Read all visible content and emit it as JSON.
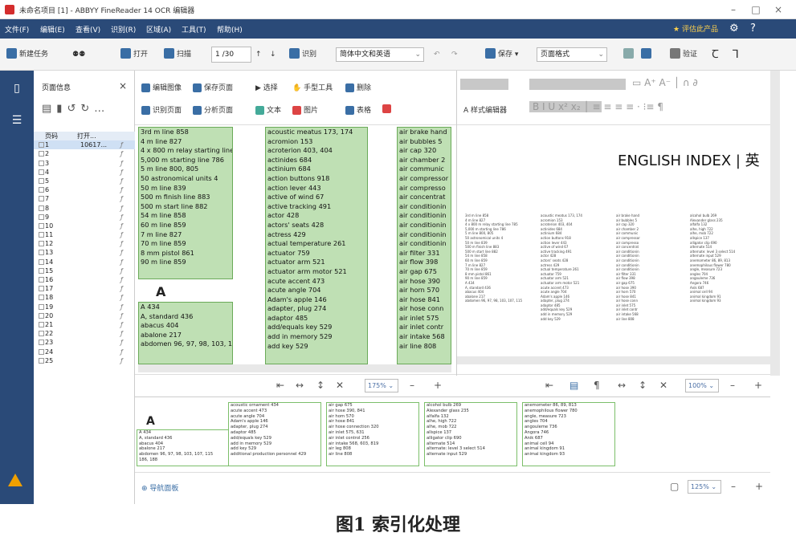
{
  "window": {
    "title": "未命名项目 [1] - ABBYY FineReader 14 OCR 编辑器",
    "min": "–",
    "max": "□",
    "close": "×"
  },
  "menu": {
    "items": [
      "文件(F)",
      "编辑(E)",
      "查看(V)",
      "识别(R)",
      "区域(A)",
      "工具(T)",
      "帮助(H)"
    ],
    "rate_label": "评估此产品"
  },
  "toolbar": {
    "new_task": "新建任务",
    "open": "打开",
    "scan": "扫描",
    "page_value": "1",
    "page_total": "/30",
    "recognize": "识别",
    "language": "简体中文和英语",
    "save": "保存",
    "layout": "页面格式",
    "verify": "验证"
  },
  "pages_panel": {
    "title": "页面信息",
    "col_page": "页码",
    "col_file": "打开...",
    "row1_file": "10617...",
    "rows": [
      "1",
      "2",
      "3",
      "4",
      "5",
      "6",
      "7",
      "8",
      "9",
      "10",
      "11",
      "12",
      "13",
      "14",
      "15",
      "16",
      "17",
      "18",
      "19",
      "20",
      "21",
      "22",
      "23",
      "24",
      "25"
    ]
  },
  "image_pane": {
    "tool_edit_image": "编辑图像",
    "tool_save_page": "保存页面",
    "tool_recognize_page": "识别页面",
    "tool_analyze_page": "分析页面",
    "tool_select": "选择",
    "tool_manual": "手型工具",
    "tool_delete": "删除",
    "tool_text": "文本",
    "tool_picture": "图片",
    "tool_table": "表格",
    "zoom": "175%",
    "letter": "A",
    "col1": [
      "3rd m line 858",
      "4 m line 827",
      "4 x 800 m relay starting line 785",
      "5,000 m starting line 786",
      "5 m line 800, 805",
      "50 astronomical units 4",
      "50 m line 839",
      "500 m finish line 883",
      "500 m start line 882",
      "54 m line 858",
      "60 m line 859",
      "7 m line 827",
      "70 m line 859",
      "8 mm pistol 861",
      "90 m line 859"
    ],
    "col1b": [
      "A 434",
      "A, standard 436",
      "abacus 404",
      "abalone 217",
      "abdomen 96, 97, 98, 103, 107, 115"
    ],
    "col2": [
      "acoustic meatus 173, 174",
      "acromion 153",
      "acroterion 403, 404",
      "actinides 684",
      "actinium 684",
      "action buttons 918",
      "action lever 443",
      "active of wind 67",
      "active tracking 491",
      "actor 428",
      "actors' seats 428",
      "actress 429",
      "actual temperature 261",
      "actuator 759",
      "actuator arm 521",
      "actuator arm motor 521",
      "acute accent 473",
      "acute angle 704",
      "Adam's apple 146",
      "adapter, plug 274",
      "adaptor 485",
      "add/equals key 529",
      "add in memory 529",
      "add key 529"
    ],
    "col3": [
      "air brake hand",
      "air bubbles 5",
      "air cap 320",
      "air chamber 2",
      "air communic",
      "air compressor",
      "air compresso",
      "air concentrat",
      "air conditionin",
      "air conditionin",
      "air conditionin",
      "air conditionin",
      "air conditionin",
      "air filter 331",
      "air flow 398",
      "air gap 675",
      "air hose 390",
      "air horn 570",
      "air hose 841",
      "air hose conn",
      "air inlet 575",
      "air inlet contr",
      "air intake 568",
      "air line 808"
    ]
  },
  "text_pane": {
    "style_editor": "样式编辑器",
    "heading": "ENGLISH INDEX | 英",
    "zoom": "100%"
  },
  "bottom_pane": {
    "letter": "A",
    "col1": [
      "A 434",
      "A, standard 436",
      "abacus 404",
      "abalone 217",
      "abdomen 96, 97, 98, 103, 107, 115",
      "186, 188"
    ],
    "col2": [
      "acoustic ornament 434",
      "acute accent 473",
      "acute angle 704",
      "Adam's apple 146",
      "adapter, plug 274",
      "adaptor 485",
      "add/equals key 529",
      "add in memory 529",
      "add key 529",
      "additional production personnel 429"
    ],
    "col3": [
      "air gap 675",
      "air hose 390, 841",
      "air horn 570",
      "air hose 841",
      "air hose connection 320",
      "air inlet 575, 631",
      "air inlet control 256",
      "air intake 568, 603, 819",
      "air leg 808",
      "air line 808"
    ],
    "col4": [
      "alcohol bulb 269",
      "Alexander glass 235",
      "alfalfa 132",
      "alhe, high 722",
      "alhe, mob 722",
      "allspice 137",
      "alligator clip 690",
      "alternate 514",
      "alternate: level 3 select 514",
      "alternate input 529"
    ],
    "col5": [
      "anemometer 86, 89, 813",
      "anemophilous flower 780",
      "angle, measure 723",
      "angles 704",
      "angouleme 736",
      "Angora 746",
      "Anik 687",
      "animal cell 94",
      "animal kingdom 91",
      "animal kingdom 93"
    ],
    "nav": "导航面板",
    "zoom": "125%"
  },
  "caption": "图1  索引化处理"
}
